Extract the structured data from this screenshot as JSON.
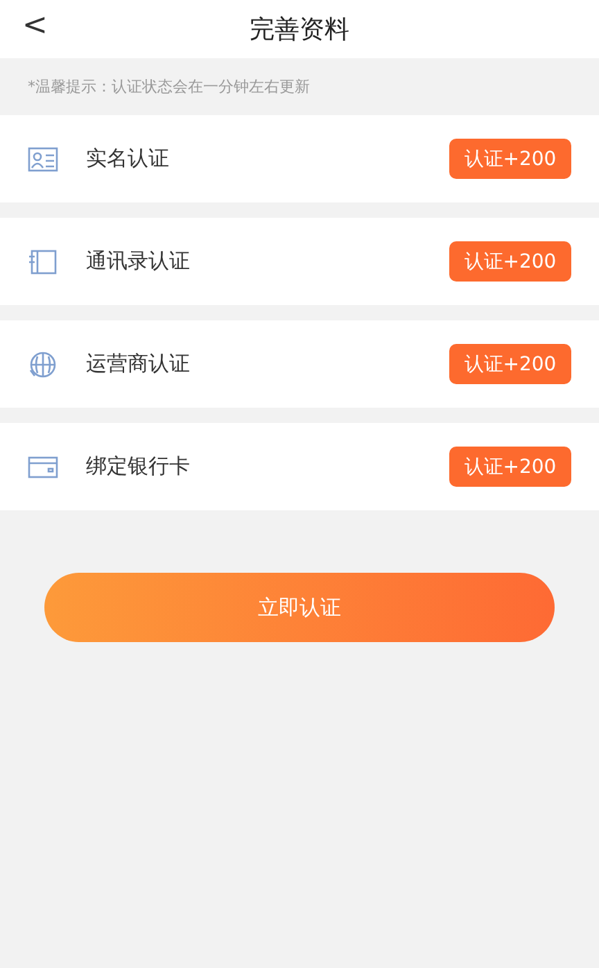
{
  "header": {
    "back": "<",
    "title": "完善资料"
  },
  "tip": "*温馨提示：认证状态会在一分钟左右更新",
  "items": [
    {
      "kind": "id-card",
      "label": "实名认证",
      "action": "认证+200"
    },
    {
      "kind": "contacts",
      "label": "通讯录认证",
      "action": "认证+200"
    },
    {
      "kind": "carrier",
      "label": "运营商认证",
      "action": "认证+200"
    },
    {
      "kind": "bank-card",
      "label": "绑定银行卡",
      "action": "认证+200"
    }
  ],
  "submit": "立即认证"
}
